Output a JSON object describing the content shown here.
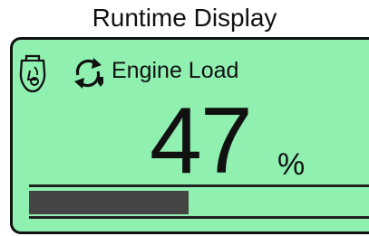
{
  "window": {
    "title": "Runtime Display"
  },
  "display": {
    "label": "Engine Load",
    "value": "47",
    "unit": "%",
    "load_fraction": 0.47,
    "background_color": "#8ff0b0",
    "bar_color": "#444444"
  },
  "icons": {
    "engine": "engine-icon",
    "auto": "auto-cycle-icon"
  }
}
